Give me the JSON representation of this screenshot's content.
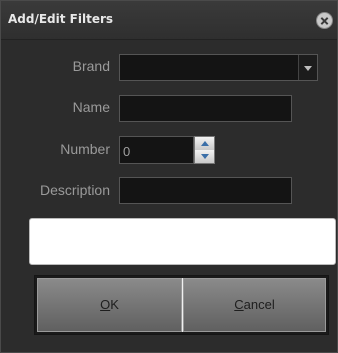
{
  "dialog": {
    "title": "Add/Edit Filters"
  },
  "form": {
    "brand_label": "Brand",
    "brand_value": "",
    "name_label": "Name",
    "name_value": "",
    "number_label": "Number",
    "number_value": "0",
    "description_label": "Description",
    "description_value": ""
  },
  "buttons": {
    "ok_mnemonic": "O",
    "ok_rest": "K",
    "cancel_mnemonic": "C",
    "cancel_rest": "ancel"
  },
  "icons": {
    "close": "close-icon",
    "dropdown": "chevron-down-icon",
    "spin_up": "chevron-up-icon",
    "spin_down": "chevron-down-icon"
  },
  "colors": {
    "dialog_bg": "#2c2c2c",
    "field_bg": "#141414",
    "label_text": "#9a9a9a",
    "button_bg": "#707070",
    "accent_arrow": "#3b6fa8"
  }
}
